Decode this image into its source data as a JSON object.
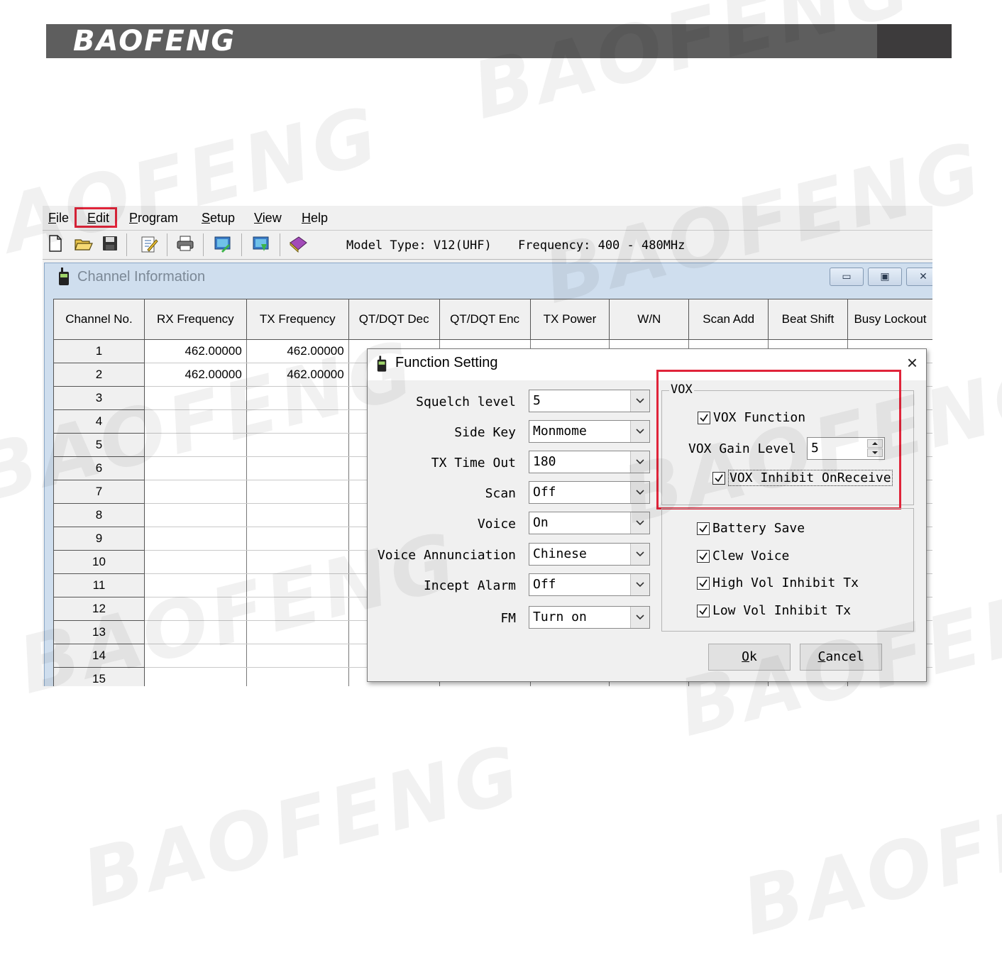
{
  "brand": {
    "logo_text": "BAOFENG",
    "watermark_text": "BAOFENG"
  },
  "menu": {
    "items": [
      {
        "accel": "F",
        "rest": "ile"
      },
      {
        "accel": "E",
        "rest": "dit"
      },
      {
        "accel": "P",
        "rest": "rogram"
      },
      {
        "accel": "S",
        "rest": "etup"
      },
      {
        "accel": "V",
        "rest": "iew"
      },
      {
        "accel": "H",
        "rest": "elp"
      }
    ],
    "highlighted": "Edit"
  },
  "toolbar": {
    "icons": [
      "new-file-icon",
      "open-folder-icon",
      "save-icon",
      "edit-icon",
      "print-icon",
      "read-radio-icon",
      "write-radio-icon",
      "book-icon"
    ],
    "model_type": "Model Type: V12(UHF)",
    "frequency": "Frequency: 400 - 480MHz"
  },
  "channel_window": {
    "title": "Channel Information",
    "buttons": [
      "minimize",
      "restore",
      "close"
    ],
    "columns": [
      "Channel No.",
      "RX Frequency",
      "TX Frequency",
      "QT/DQT Dec",
      "QT/DQT Enc",
      "TX Power",
      "W/N",
      "Scan Add",
      "Beat Shift",
      "Busy Lockout"
    ],
    "rows": [
      {
        "ch": "1",
        "rx": "462.00000",
        "tx": "462.00000"
      },
      {
        "ch": "2",
        "rx": "462.00000",
        "tx": "462.00000"
      },
      {
        "ch": "3",
        "rx": "",
        "tx": ""
      },
      {
        "ch": "4",
        "rx": "",
        "tx": ""
      },
      {
        "ch": "5",
        "rx": "",
        "tx": ""
      },
      {
        "ch": "6",
        "rx": "",
        "tx": ""
      },
      {
        "ch": "7",
        "rx": "",
        "tx": ""
      },
      {
        "ch": "8",
        "rx": "",
        "tx": ""
      },
      {
        "ch": "9",
        "rx": "",
        "tx": ""
      },
      {
        "ch": "10",
        "rx": "",
        "tx": ""
      },
      {
        "ch": "11",
        "rx": "",
        "tx": ""
      },
      {
        "ch": "12",
        "rx": "",
        "tx": ""
      },
      {
        "ch": "13",
        "rx": "",
        "tx": ""
      },
      {
        "ch": "14",
        "rx": "",
        "tx": ""
      },
      {
        "ch": "15",
        "rx": "",
        "tx": ""
      }
    ]
  },
  "dialog": {
    "title": "Function Setting",
    "close": "×",
    "fields": [
      {
        "label": "Squelch level",
        "value": "5"
      },
      {
        "label": "Side Key",
        "value": "Monmome"
      },
      {
        "label": "TX Time Out",
        "value": "180"
      },
      {
        "label": "Scan",
        "value": "Off"
      },
      {
        "label": "Voice",
        "value": "On"
      },
      {
        "label": "Voice Annunciation",
        "value": "Chinese"
      },
      {
        "label": "Incept Alarm",
        "value": "Off"
      },
      {
        "label": "FM",
        "value": "Turn on"
      }
    ],
    "vox": {
      "legend": "VOX",
      "function_label": "VOX Function",
      "function_checked": true,
      "gain_label": "VOX Gain Level",
      "gain_value": "5",
      "inhibit_label": "VOX Inhibit OnReceive",
      "inhibit_checked": true
    },
    "options": [
      {
        "label": "Battery Save",
        "checked": true
      },
      {
        "label": "Clew Voice",
        "checked": true
      },
      {
        "label": "High Vol Inhibit Tx",
        "checked": true
      },
      {
        "label": "Low Vol Inhibit Tx",
        "checked": true
      }
    ],
    "ok": {
      "accel": "O",
      "rest": "k"
    },
    "cancel": {
      "accel": "C",
      "rest": "ancel"
    }
  },
  "colors": {
    "highlight": "#e0243a",
    "brand_bar": "#5e5e5e",
    "brand_bar_dark": "#3d3b3c",
    "mdi_title_bg": "#cfdeee"
  }
}
